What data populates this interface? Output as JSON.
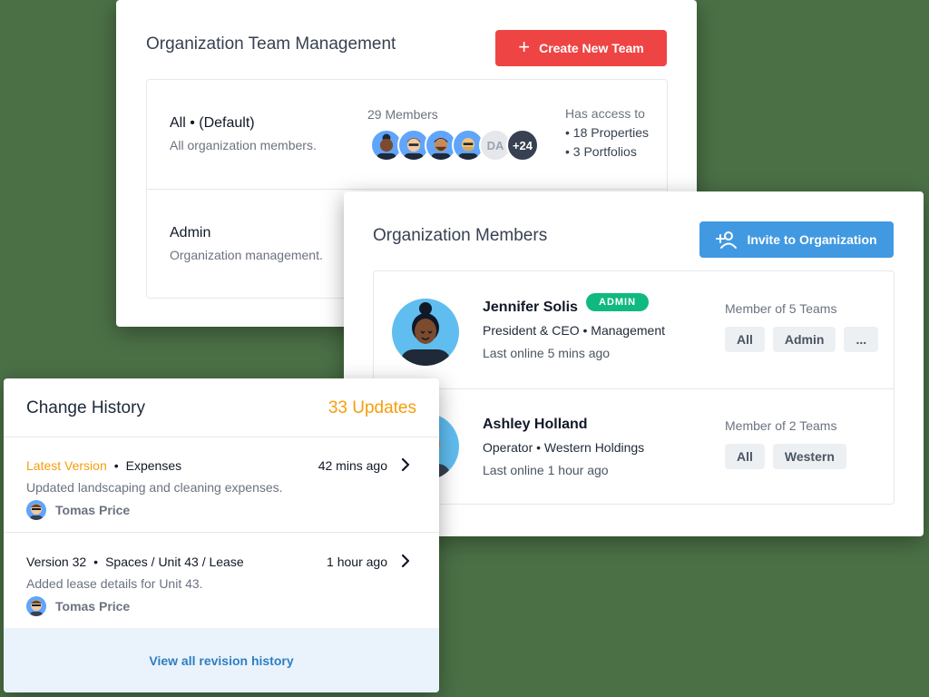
{
  "team_management": {
    "title": "Organization Team Management",
    "create_button_label": "Create New Team",
    "teams": [
      {
        "name": "All • (Default)",
        "description": "All organization members.",
        "members_label": "29 Members",
        "avatar_initials": "DA",
        "more_count": "+24",
        "access_label": "Has access to",
        "access_items": [
          "• 18 Properties",
          "• 3 Portfolios"
        ]
      },
      {
        "name": "Admin",
        "description": "Organization management."
      }
    ]
  },
  "org_members": {
    "title": "Organization Members",
    "invite_button_label": "Invite to Organization",
    "members": [
      {
        "name": "Jennifer Solis",
        "badge": "ADMIN",
        "role": "President & CEO • Management",
        "last_online": "Last online 5 mins ago",
        "teams_label": "Member of 5 Teams",
        "teams": [
          "All",
          "Admin",
          "..."
        ]
      },
      {
        "name": "Ashley Holland",
        "role": "Operator • Western Holdings",
        "last_online": "Last online 1 hour ago",
        "teams_label": "Member of 2 Teams",
        "teams": [
          "All",
          "Western"
        ]
      }
    ]
  },
  "change_history": {
    "title": "Change History",
    "updates_count": "33 Updates",
    "entries": [
      {
        "version": "Latest Version",
        "area": "Expenses",
        "time": "42 mins ago",
        "description": "Updated landscaping and cleaning expenses.",
        "author": "Tomas Price"
      },
      {
        "version": "Version 32",
        "area": "Spaces / Unit 43 / Lease",
        "time": "1 hour ago",
        "description": "Added lease details for Unit 43.",
        "author": "Tomas Price"
      }
    ],
    "view_all_label": "View all revision history"
  },
  "icons": {
    "create": "plus-icon",
    "invite": "user-plus-icon",
    "history_row": "chevron-right-icon"
  },
  "colors": {
    "background": "#4b7046",
    "create_button": "#ef4444",
    "invite_button": "#4199e1",
    "admin_badge": "#10b981",
    "accent_orange": "#f59e0b",
    "link_blue": "#2f7ec2"
  }
}
